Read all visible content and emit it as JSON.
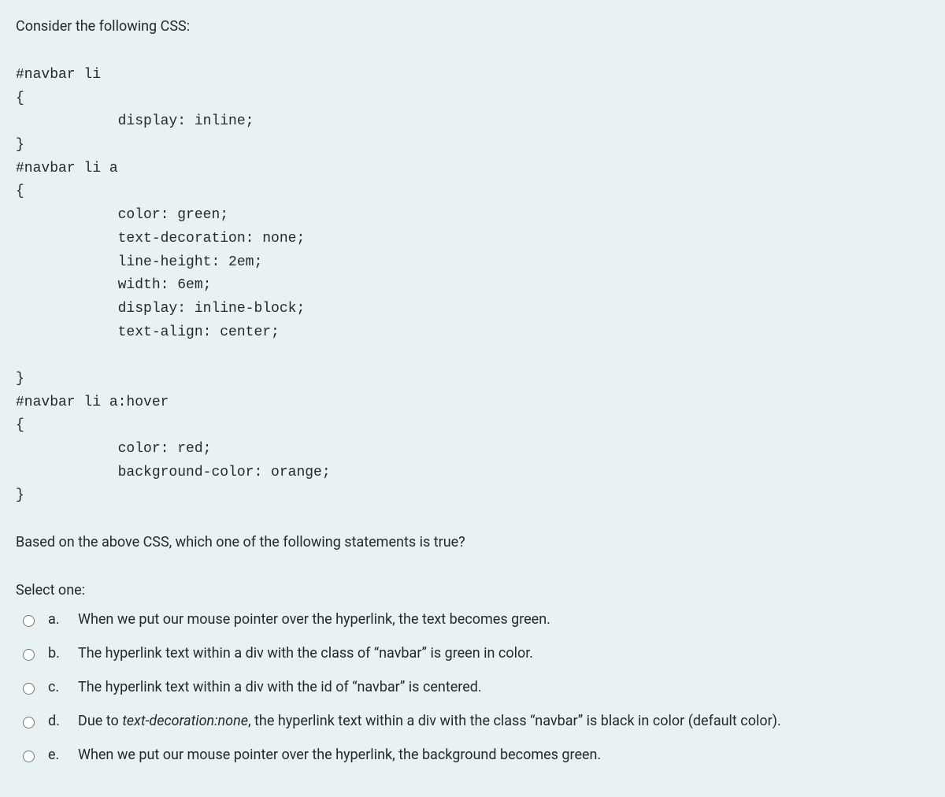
{
  "question_intro": "Consider the following CSS:",
  "code_block": "#navbar li\n{\n            display: inline;\n}\n#navbar li a\n{\n            color: green;\n            text-decoration: none;\n            line-height: 2em;\n            width: 6em;\n            display: inline-block;\n            text-align: center;\n\n}\n#navbar li a:hover\n{\n            color: red;\n            background-color: orange;\n}",
  "question_prompt": "Based on the above CSS, which one of the following statements is true?",
  "select_label": "Select one:",
  "options": [
    {
      "letter": "a.",
      "text": "When we put our mouse pointer over the hyperlink, the text becomes green."
    },
    {
      "letter": "b.",
      "text": "The hyperlink text within a div with the class of “navbar” is green in color."
    },
    {
      "letter": "c.",
      "text": "The hyperlink text within a div with the id of “navbar” is centered."
    },
    {
      "letter": "d.",
      "text_prefix": "Due to ",
      "text_italic": "text-decoration:none",
      "text_suffix": ", the hyperlink text within a div with the class “navbar” is black in color (default color)."
    },
    {
      "letter": "e.",
      "text": "When we put our mouse pointer over the hyperlink, the background becomes green."
    }
  ]
}
